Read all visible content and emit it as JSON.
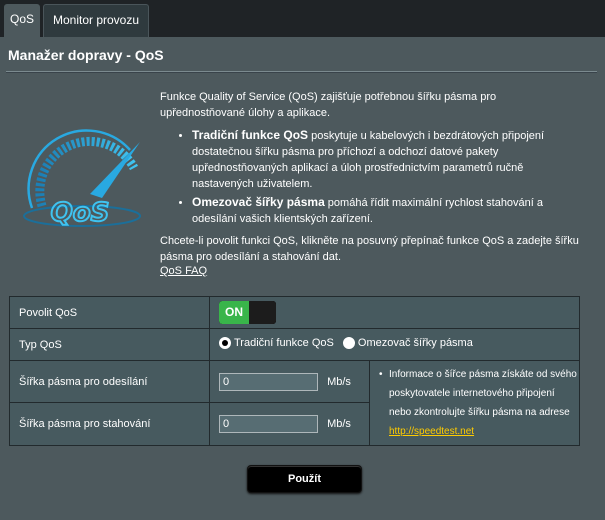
{
  "tabs": [
    {
      "label": "QoS"
    },
    {
      "label": "Monitor provozu"
    }
  ],
  "page": {
    "title": "Manažer dopravy - QoS"
  },
  "logo": {
    "text": "QoS"
  },
  "description": {
    "intro": "Funkce Quality of Service (QoS) zajišťuje potřebnou šířku pásma pro upřednostňované úlohy a aplikace.",
    "bullet1_bold": "Tradiční funkce QoS",
    "bullet1_text": " poskytuje u kabelových i bezdrátových připojení dostatečnou šířku pásma pro příchozí a odchozí datové pakety upřednostňovaných aplikací a úloh prostřednictvím parametrů ručně nastavených uživatelem.",
    "bullet2_bold": "Omezovač šířky pásma",
    "bullet2_text": " pomáhá řídit maximální rychlost stahování a odesílání vašich klientských zařízení.",
    "outro": "Chcete-li povolit funkci QoS, klikněte na posuvný přepínač funkce QoS a zadejte šířku pásma pro odesílání a stahování dat."
  },
  "faq_link": "QoS FAQ",
  "form": {
    "enable_label": "Povolit QoS",
    "toggle_state": "ON",
    "type_label": "Typ QoS",
    "type_options": [
      "Tradiční funkce QoS",
      "Omezovač šířky pásma"
    ],
    "type_selected": "Tradiční funkce QoS",
    "upload_label": "Šířka pásma pro odesílání",
    "upload_value": "0",
    "upload_unit": "Mb/s",
    "download_label": "Šířka pásma pro stahování",
    "download_value": "0",
    "download_unit": "Mb/s",
    "info_text": "Informace o šířce pásma získáte od svého poskytovatele internetového připojení nebo zkontrolujte šířku pásma na adrese ",
    "info_link": "http://speedtest.net"
  },
  "apply_label": "Použít",
  "colors": {
    "background": "#1f2326",
    "panel": "#4d595d",
    "toggle_on": "#39b54a",
    "link": "#ffcc00",
    "logo_accent": "#29a9e1"
  }
}
